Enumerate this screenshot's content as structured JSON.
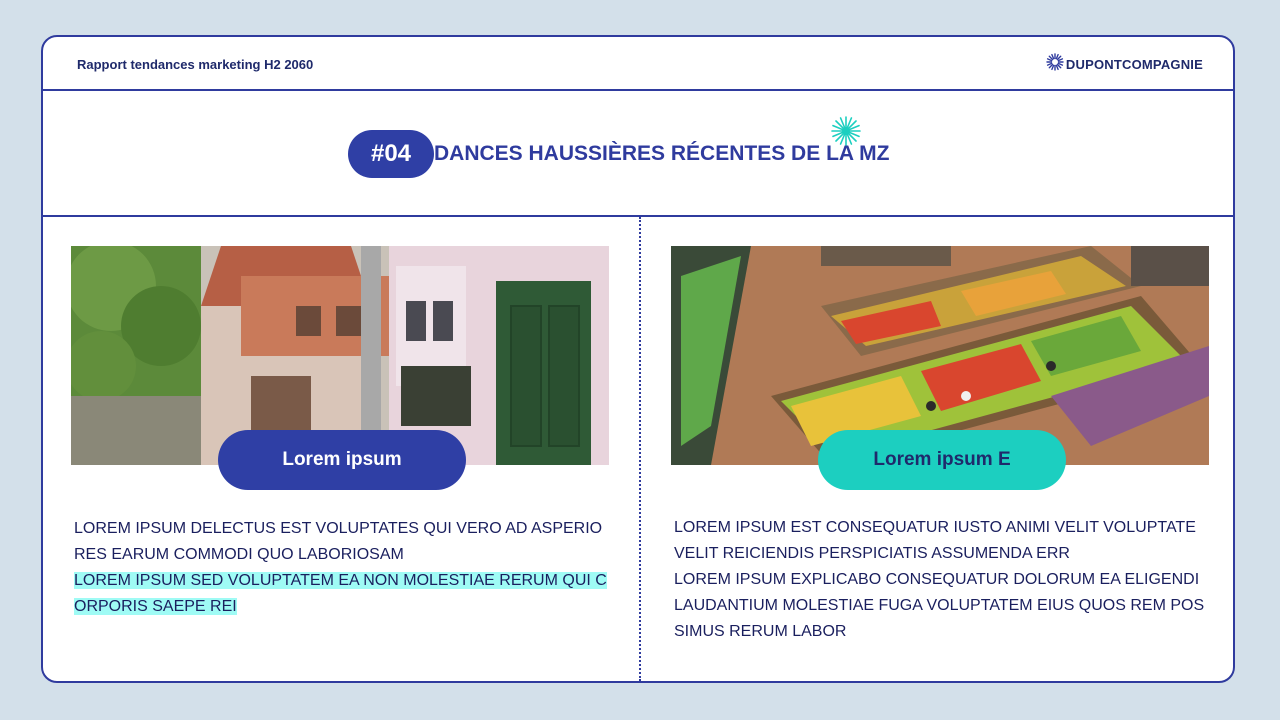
{
  "header": {
    "report_title": "Rapport tendances marketing H2 2060",
    "brand": "DUPONTCOMPAGNIE"
  },
  "slide": {
    "number": "#04",
    "title": "DANCES HAUSSIÈRES RÉCENTES DE LA MZ"
  },
  "colors": {
    "primary": "#2f3b9e",
    "pill_dark": "#2f3fa5",
    "pill_teal": "#1ccfc0",
    "highlight": "#9ffbf5",
    "background": "#d3e0ea"
  },
  "left_panel": {
    "image": "village-street-photo",
    "label": "Lorem ipsum",
    "paragraph_1": "LOREM IPSUM DELECTUS EST VOLUPTATES QUI VERO AD ASPERIORES EARUM COMMODI QUO LABORIOSAM",
    "paragraph_2_highlighted": "LOREM IPSUM SED VOLUPTATEM EA NON MOLESTIAE RERUM QUI CORPORIS SAEPE REI"
  },
  "right_panel": {
    "image": "supermarket-produce-photo",
    "label": "Lorem ipsum E",
    "paragraph_1": "LOREM IPSUM EST CONSEQUATUR IUSTO ANIMI VELIT VOLUPTATE VELIT REICIENDIS PERSPICIATIS ASSUMENDA ERR",
    "paragraph_2": "LOREM IPSUM EXPLICABO CONSEQUATUR DOLORUM EA ELIGENDI LAUDANTIUM MOLESTIAE FUGA VOLUPTATEM EIUS QUOS REM POSSIMUS RERUM LABOR"
  }
}
